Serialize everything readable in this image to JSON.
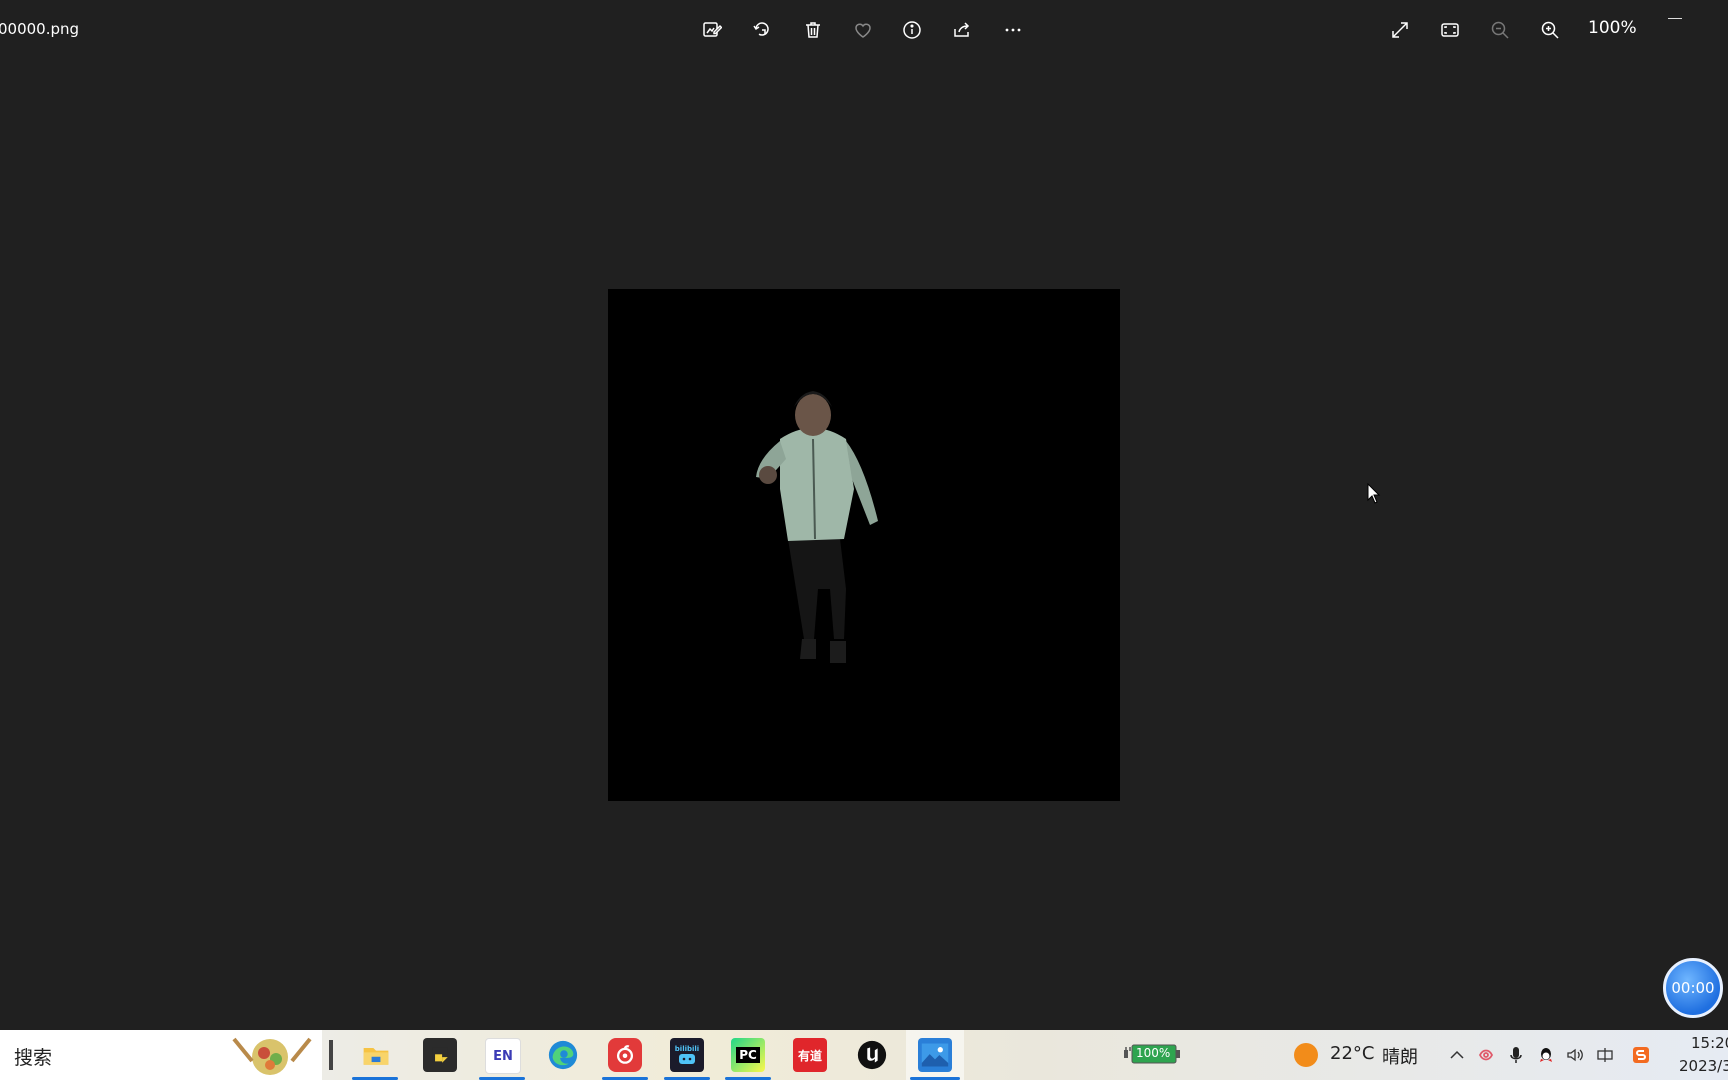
{
  "window": {
    "filename": "00000.png",
    "toolbar": {
      "edit_icon": "edit-image-icon",
      "rotate_icon": "rotate-icon",
      "delete_icon": "trash-icon",
      "favorite_icon": "heart-icon",
      "info_icon": "info-icon",
      "share_icon": "share-icon",
      "more_icon": "more-icon"
    },
    "right_controls": {
      "fullscreen_icon": "expand-icon",
      "fit_icon": "fit-to-window-icon",
      "zoom_out_icon": "zoom-out-icon",
      "zoom_in_icon": "zoom-in-icon",
      "zoom_level": "100%"
    }
  },
  "image": {
    "description_icon": "person-photo",
    "background": "#000000"
  },
  "timer": {
    "label": "00:00"
  },
  "taskbar": {
    "search_placeholder": "搜索",
    "apps": [
      {
        "name": "file-explorer",
        "label": ""
      },
      {
        "name": "sticky-notes",
        "label": ""
      },
      {
        "name": "en-app",
        "label": "EN"
      },
      {
        "name": "edge",
        "label": ""
      },
      {
        "name": "netease-music",
        "label": ""
      },
      {
        "name": "bilibili",
        "label": "bilibili"
      },
      {
        "name": "pycharm",
        "label": "PC"
      },
      {
        "name": "youdao",
        "label": "有道"
      },
      {
        "name": "unreal-engine",
        "label": ""
      },
      {
        "name": "photos",
        "label": ""
      }
    ],
    "battery_label": "100%",
    "weather": {
      "temp": "22°C",
      "condition": "晴朗"
    },
    "clock": {
      "time": "15:20",
      "date": "2023/3"
    }
  },
  "colors": {
    "window_bg": "#202020",
    "accent": "#1a73d9"
  }
}
